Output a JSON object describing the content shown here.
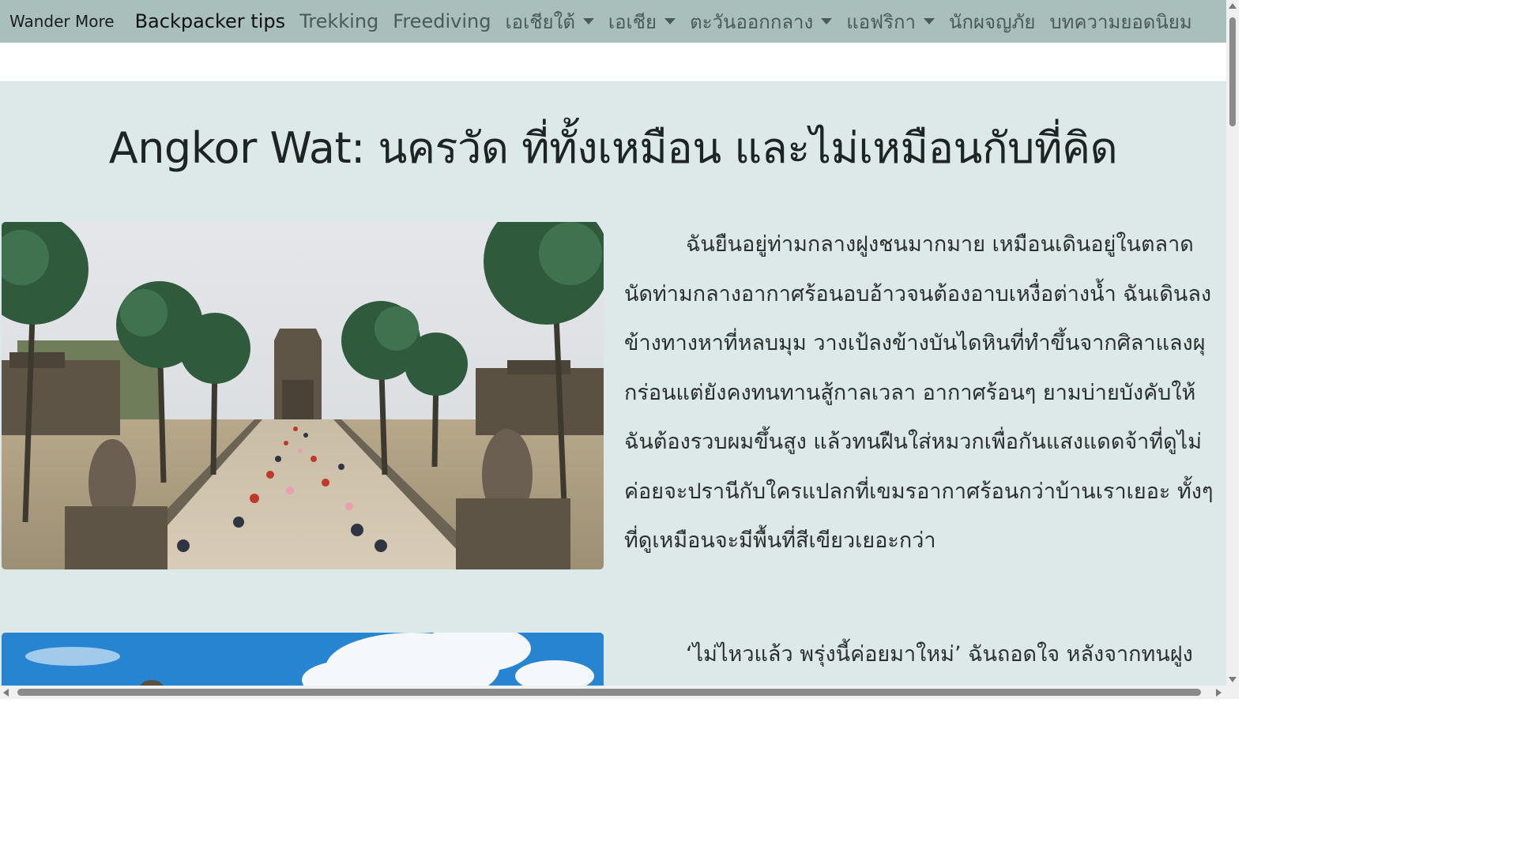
{
  "navbar": {
    "brand": "Wander More",
    "items": [
      {
        "label": "Backpacker tips",
        "dropdown": false,
        "active": true
      },
      {
        "label": "Trekking",
        "dropdown": false,
        "active": false
      },
      {
        "label": "Freediving",
        "dropdown": false,
        "active": false
      },
      {
        "label": "เอเชียใต้",
        "dropdown": true,
        "active": false
      },
      {
        "label": "เอเชีย",
        "dropdown": true,
        "active": false
      },
      {
        "label": "ตะวันออกกลาง",
        "dropdown": true,
        "active": false
      },
      {
        "label": "แอฟริกา",
        "dropdown": true,
        "active": false
      },
      {
        "label": "นักผจญภัย",
        "dropdown": false,
        "active": false
      },
      {
        "label": "บทความยอดนิยม",
        "dropdown": false,
        "active": false
      }
    ]
  },
  "article": {
    "title": "Angkor Wat: นครวัด ที่ทั้งเหมือน และไม่เหมือนกับที่คิด",
    "paragraphs": [
      "ฉันยืนอยู่ท่ามกลางฝูงชนมากมาย เหมือนเดินอยู่ในตลาดนัดท่ามกลางอากาศร้อนอบอ้าวจนต้องอาบเหงื่อต่างน้ำ ฉันเดินลงข้างทางหาที่หลบมุม วางเป้ลงข้างบันไดหินที่ทำขึ้นจากศิลาแลงผุกร่อนแต่ยังคงทนทานสู้กาลเวลา อากาศร้อนๆ ยามบ่ายบังคับให้ฉันต้องรวบผมขึ้นสูง แล้วทนฝืนใส่หมวกเพื่อกันแสงแดดจ้าที่ดูไม่ค่อยจะปรานีกับใครแปลกที่เขมรอากาศร้อนกว่าบ้านเราเยอะ ทั้งๆ ที่ดูเหมือนจะมีพื้นที่สีเขียวเยอะกว่า",
      "‘ไม่ไหวแล้ว พรุ่งนี้ค่อยมาใหม่’ ฉันถอดใจ หลังจากทนฝูงชนที่"
    ]
  }
}
